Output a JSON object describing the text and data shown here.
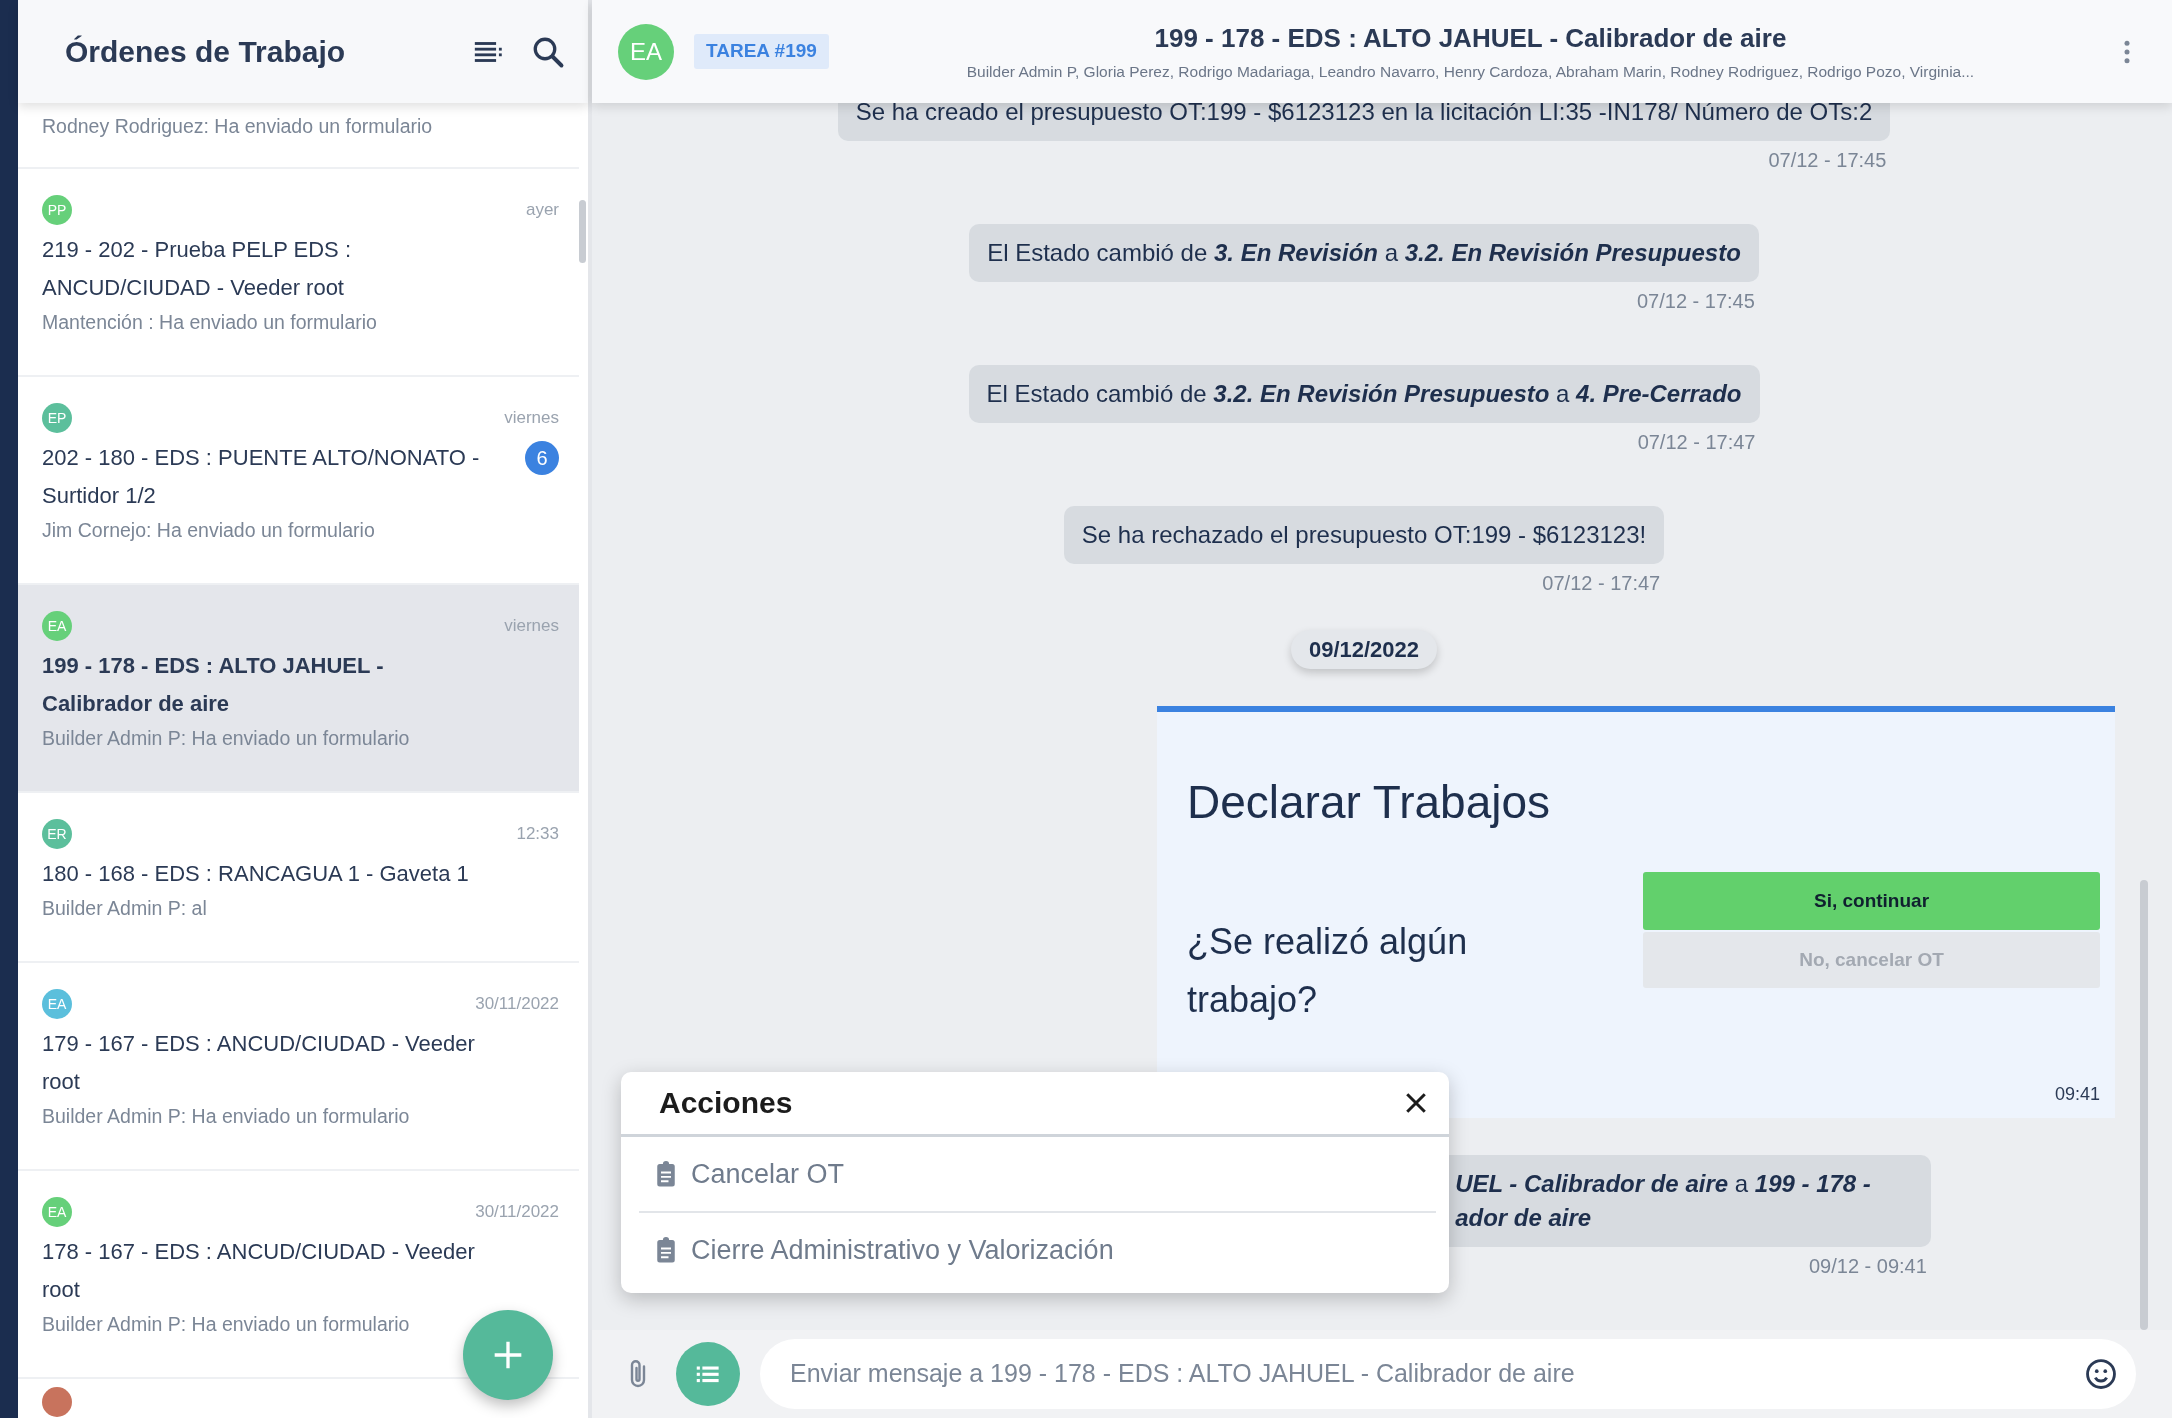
{
  "sidebar": {
    "title": "Órdenes de Trabajo",
    "items": [
      {
        "preview": "Rodney Rodriguez: Ha enviado un formulario",
        "selected": false
      },
      {
        "initials": "PP",
        "color": "#66d07a",
        "time": "ayer",
        "title": "219 - 202 - Prueba PELP EDS : ANCUD/CIUDAD - Veeder root",
        "preview": "Mantención : Ha enviado un formulario",
        "selected": false
      },
      {
        "initials": "EP",
        "color": "#5cbf9c",
        "time": "viernes",
        "badge": "6",
        "title": "202 - 180 - EDS : PUENTE ALTO/NONATO - Surtidor 1/2",
        "preview": "Jim Cornejo: Ha enviado un formulario",
        "selected": false
      },
      {
        "initials": "EA",
        "color": "#66d07a",
        "time": "viernes",
        "title": "199 - 178 - EDS : ALTO JAHUEL - Calibrador de aire",
        "preview": "Builder Admin P: Ha enviado un formulario",
        "selected": true
      },
      {
        "initials": "ER",
        "color": "#5cbf9c",
        "time": "12:33",
        "title": "180 - 168 - EDS : RANCAGUA 1 - Gaveta 1",
        "preview": "Builder Admin P: al",
        "selected": false
      },
      {
        "initials": "EA",
        "color": "#5bbfdc",
        "time": "30/11/2022",
        "title": "179 - 167 - EDS : ANCUD/CIUDAD - Veeder root",
        "preview": "Builder Admin P: Ha enviado un formulario",
        "selected": false
      },
      {
        "initials": "EA",
        "color": "#66d07a",
        "time": "30/11/2022",
        "title": "178 - 167 - EDS : ANCUD/CIUDAD - Veeder root",
        "preview": "Builder Admin P: Ha enviado un formulario",
        "selected": false
      },
      {
        "color": "#c8735d",
        "selected": false
      }
    ]
  },
  "chat": {
    "initials": "EA",
    "tag": "TAREA #199",
    "title": "199 - 178 - EDS : ALTO JAHUEL - Calibrador de aire",
    "participants": "Builder Admin P, Gloria Perez, Rodrigo Madariaga, Leandro Navarro, Henry Cardoza, Abraham Marin, Rodney Rodriguez, Rodrigo Pozo, Virginia...",
    "messages": [
      {
        "kind": "system",
        "text": "Se ha creado el presupuesto OT:199 - $6123123 en la licitación LI:35 -IN178/ Número de OTs:2",
        "time": "07/12 - 17:45"
      },
      {
        "kind": "system",
        "text": "El Estado cambió de **3. En Revisión** a **3.2. En Revisión Presupuesto**",
        "time": "07/12 - 17:45"
      },
      {
        "kind": "system",
        "text": "El Estado cambió de **3.2. En Revisión Presupuesto** a **4. Pre-Cerrado**",
        "time": "07/12 - 17:47"
      },
      {
        "kind": "system",
        "text": "Se ha rechazado el presupuesto OT:199 - $6123123!",
        "time": "07/12 - 17:47"
      },
      {
        "kind": "date",
        "text": "09/12/2022"
      },
      {
        "kind": "form",
        "title": "Declarar Trabajos",
        "question": "¿Se realizó algún trabajo?",
        "buttons": [
          {
            "label": "Si, continuar",
            "kind": "primary"
          },
          {
            "label": "No, cancelar OT",
            "kind": "secondary"
          }
        ],
        "time": "09:41"
      },
      {
        "kind": "covered_system",
        "lines": [
          "**UEL - Calibrador de aire** a **199 - 178 -**",
          "**ador de aire**"
        ],
        "time": "09/12 - 09:41"
      }
    ]
  },
  "actions_popup": {
    "title": "Acciones",
    "items": [
      "Cancelar OT",
      "Cierre Administrativo y Valorización"
    ]
  },
  "composer": {
    "placeholder": "Enviar mensaje a 199 - 178 - EDS : ALTO JAHUEL - Calibrador de aire"
  }
}
